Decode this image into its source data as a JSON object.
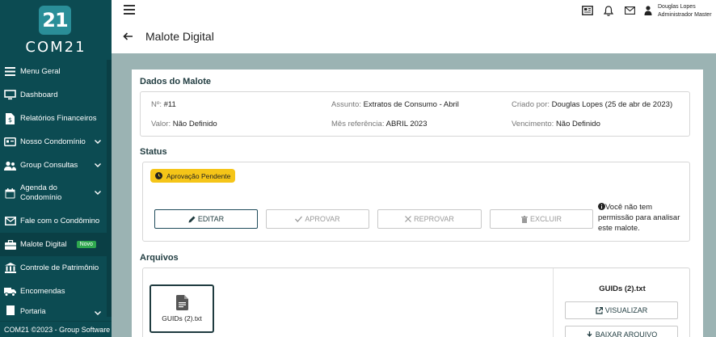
{
  "brand": {
    "logo_text": "21",
    "name": "COM21"
  },
  "sidebar": {
    "items": [
      {
        "label": "Menu Geral",
        "icon": "menu-icon"
      },
      {
        "label": "Dashboard",
        "icon": "monitor-icon"
      },
      {
        "label": "Relatórios Financeiros",
        "icon": "document-dollar-icon"
      },
      {
        "label": "Nosso Condomínio",
        "icon": "id-card-icon"
      },
      {
        "label": "Group Consultas",
        "icon": "user-group-icon"
      },
      {
        "label": "Agenda do Condomínio",
        "icon": "calendar-icon"
      },
      {
        "label": "Fale com o Condômino",
        "icon": "mail-icon"
      },
      {
        "label": "Malote Digital",
        "icon": "briefcase-icon",
        "badge": "Novo"
      },
      {
        "label": "Controle de Patrimônio",
        "icon": "bank-icon"
      },
      {
        "label": "Encomendas",
        "icon": "truck-icon"
      },
      {
        "label": "Portaria",
        "icon": "door-icon"
      }
    ],
    "footer": "COM21 ©2023 - Group Software"
  },
  "header": {
    "title": "Malote Digital",
    "user_name": "Douglas Lopes",
    "user_role": "Administrador Master"
  },
  "dados": {
    "title": "Dados do Malote",
    "numero_label": "Nº:",
    "numero": "#11",
    "assunto_label": "Assunto:",
    "assunto": "Extratos de Consumo - Abril",
    "criado_label": "Criado por:",
    "criado": "Douglas Lopes (25 de abr de 2023)",
    "valor_label": "Valor:",
    "valor": "Não Definido",
    "mes_label": "Mês referência:",
    "mes": "ABRIL 2023",
    "venc_label": "Vencimento:",
    "venc": "Não Definido"
  },
  "status": {
    "title": "Status",
    "badge": "Aprovação Pendente",
    "badge_color": "#f5c518",
    "buttons": {
      "editar": "EDITAR",
      "aprovar": "APROVAR",
      "reprovar": "REPROVAR",
      "excluir": "EXCLUIR"
    },
    "permission_note": "Você não tem permissão para analisar este malote."
  },
  "arquivos": {
    "title": "Arquivos",
    "file_name": "GUIDs (2).txt",
    "selected_name": "GUIDs (2).txt",
    "visualizar": "VISUALIZAR",
    "baixar": "BAIXAR ARQUIVO"
  },
  "colors": {
    "sidebar": "#0c4b52",
    "accent": "#2a8e98",
    "content_bg": "#9bb3b3",
    "badge_novo": "#2fa84f"
  }
}
